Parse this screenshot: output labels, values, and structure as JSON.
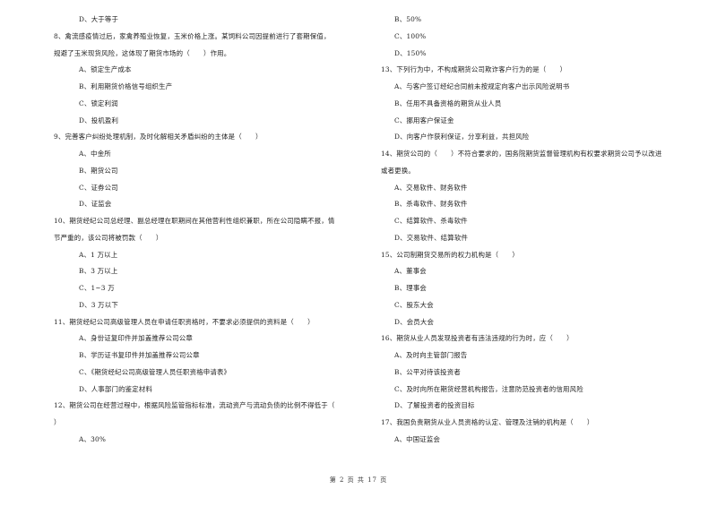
{
  "left_column": [
    {
      "type": "option",
      "text": "D、大于等于"
    },
    {
      "type": "question",
      "lines": [
        "8、禽流感疫情过后，家禽养殖业恢复，玉米价格上涨。某饲料公司因提前进行了套期保值，",
        "规避了玉米现货风险，这体现了期货市场的（　　）作用。"
      ]
    },
    {
      "type": "option",
      "text": "A、锁定生产成本"
    },
    {
      "type": "option",
      "text": "B、利用期货价格信号组织生产"
    },
    {
      "type": "option",
      "text": "C、锁定利润"
    },
    {
      "type": "option",
      "text": "D、投机盈利"
    },
    {
      "type": "question",
      "lines": [
        "9、完善客户纠纷处理机制，及时化解相关矛盾纠纷的主体是（　　）"
      ]
    },
    {
      "type": "option",
      "text": "A、中金所"
    },
    {
      "type": "option",
      "text": "B、期货公司"
    },
    {
      "type": "option",
      "text": "C、证券公司"
    },
    {
      "type": "option",
      "text": "D、证监会"
    },
    {
      "type": "question",
      "lines": [
        "10、期货经纪公司总经理、副总经理在职期间在其他营利性组织兼职，所在公司隐瞒不报，情",
        "节严重的，该公司将被罚款（　　）"
      ]
    },
    {
      "type": "option",
      "text": "A、1 万以上"
    },
    {
      "type": "option",
      "text": "B、3 万以上"
    },
    {
      "type": "option",
      "text": "C、1~3 万"
    },
    {
      "type": "option",
      "text": "D、3 万以下"
    },
    {
      "type": "question",
      "lines": [
        "11、期货经纪公司高级管理人员在申请任职资格时，不要求必须提供的资料是（　　）"
      ]
    },
    {
      "type": "option",
      "text": "A、身份证复印件并加盖推荐公司公章"
    },
    {
      "type": "option",
      "text": "B、学历证书复印件并加盖推荐公司公章"
    },
    {
      "type": "option",
      "text": "C、《期货经纪公司高级管理人员任职资格申请表》"
    },
    {
      "type": "option",
      "text": "D、人事部门的鉴定材料"
    },
    {
      "type": "question",
      "lines": [
        "12、期货公司在经营过程中，根据风险监管指标标准，流动资产与流动负债的比例不得低于（",
        "）"
      ]
    },
    {
      "type": "option",
      "text": "A、30%"
    }
  ],
  "right_column": [
    {
      "type": "option",
      "text": "B、50%"
    },
    {
      "type": "option",
      "text": "C、100%"
    },
    {
      "type": "option",
      "text": "D、150%"
    },
    {
      "type": "question",
      "lines": [
        "13、下列行为中，不构成期货公司欺诈客户行为的是（　　）"
      ]
    },
    {
      "type": "option",
      "text": "A、与客户签订经纪合同前未按规定向客户出示风险说明书"
    },
    {
      "type": "option",
      "text": "B、任用不具备资格的期货从业人员"
    },
    {
      "type": "option",
      "text": "C、挪用客户保证金"
    },
    {
      "type": "option",
      "text": "D、向客户作获利保证，分享利益，共担风险"
    },
    {
      "type": "question",
      "lines": [
        "14、期货公司的（　　）不符合要求的，国务院期货监督管理机构有权要求期货公司予以改进",
        "或者更换。"
      ]
    },
    {
      "type": "option",
      "text": "A、交易软件、财务软件"
    },
    {
      "type": "option",
      "text": "B、杀毒软件、财务软件"
    },
    {
      "type": "option",
      "text": "C、结算软件、杀毒软件"
    },
    {
      "type": "option",
      "text": "D、交易软件、结算软件"
    },
    {
      "type": "question",
      "lines": [
        "15、公司制期货交易所的权力机构是（　　）"
      ]
    },
    {
      "type": "option",
      "text": "A、董事会"
    },
    {
      "type": "option",
      "text": "B、理事会"
    },
    {
      "type": "option",
      "text": "C、股东大会"
    },
    {
      "type": "option",
      "text": "D、会员大会"
    },
    {
      "type": "question",
      "lines": [
        "16、期货从业人员发现投资者有违法违规的行为时，应（　　）"
      ]
    },
    {
      "type": "option",
      "text": "A、及时向主管部门报告"
    },
    {
      "type": "option",
      "text": "B、公平对待该投资者"
    },
    {
      "type": "option",
      "text": "C、及时向所在期货经营机构报告，注意防范投资者的信用风险"
    },
    {
      "type": "option",
      "text": "D、了解投资者的投资目标"
    },
    {
      "type": "question",
      "lines": [
        "17、我国负责期货从业人员资格的认定、管理及注销的机构是（　　）"
      ]
    },
    {
      "type": "option",
      "text": "A、中国证监会"
    }
  ],
  "footer": {
    "page_label": "第 2 页 共 17 页"
  }
}
